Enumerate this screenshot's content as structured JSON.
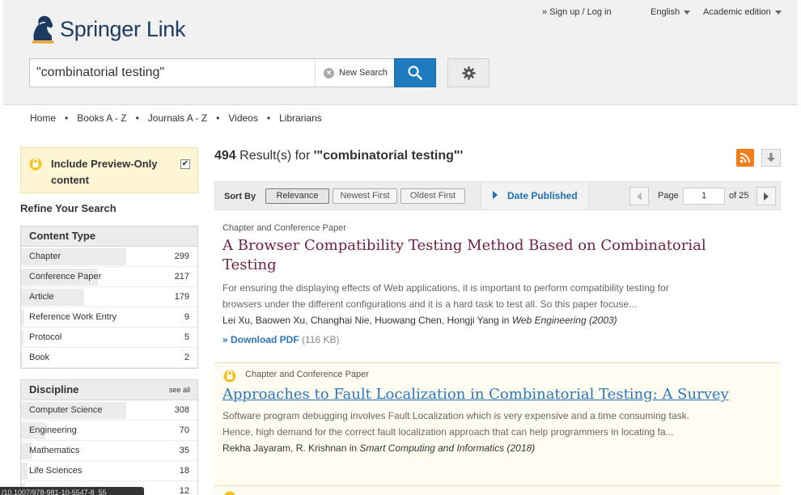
{
  "header": {
    "logo_brand": "Springer",
    "logo_suffix": "Link",
    "signin": "» Sign up / Log in",
    "language": "English",
    "edition": "Academic edition"
  },
  "search": {
    "query": "\"combinatorial testing\"",
    "new_search_label": "New Search"
  },
  "nav": [
    "Home",
    "Books A - Z",
    "Journals A - Z",
    "Videos",
    "Librarians"
  ],
  "sidebar": {
    "preview_label_line1": "Include Preview-Only",
    "preview_label_line2": "content",
    "preview_checked": "✔",
    "refine_title": "Refine Your Search",
    "content_type": {
      "title": "Content Type",
      "items": [
        {
          "label": "Chapter",
          "count": "299",
          "fraction": 1.0
        },
        {
          "label": "Conference Paper",
          "count": "217",
          "fraction": 0.73
        },
        {
          "label": "Article",
          "count": "179",
          "fraction": 0.6
        },
        {
          "label": "Reference Work Entry",
          "count": "9",
          "fraction": 0.03
        },
        {
          "label": "Protocol",
          "count": "5",
          "fraction": 0.02
        },
        {
          "label": "Book",
          "count": "2",
          "fraction": 0.01
        }
      ]
    },
    "discipline": {
      "title": "Discipline",
      "see_all": "see all",
      "items": [
        {
          "label": "Computer Science",
          "count": "308",
          "fraction": 1.0
        },
        {
          "label": "Engineering",
          "count": "70",
          "fraction": 0.23
        },
        {
          "label": "Mathematics",
          "count": "35",
          "fraction": 0.11
        },
        {
          "label": "Life Sciences",
          "count": "18",
          "fraction": 0.06
        },
        {
          "label": "",
          "count": "12",
          "fraction": 0.04
        }
      ]
    }
  },
  "results": {
    "count": "494",
    "label": "Result(s) for",
    "query": "'\"combinatorial testing\"'",
    "sort_label": "Sort By",
    "sort_options": [
      "Relevance",
      "Newest First",
      "Oldest First"
    ],
    "date_published": "Date Published",
    "page_label": "Page",
    "page_value": "1",
    "page_of": "of 25",
    "items": [
      {
        "type": "Chapter and Conference Paper",
        "title_line1": "A Browser Compatibility Testing Method Based on Combinatorial",
        "title_line2": "Testing",
        "snippet_line1": "For ensuring the displaying effects of Web applications, it is important to perform compatibility testing for",
        "snippet_line2": "browsers under the different configurations and it is a hard task to test all. So this paper focuse...",
        "authors": "Lei Xu, Baowen Xu, Changhai Nie, Huowang Chen, Hongji Yang in",
        "source": "Web Engineering (2003)",
        "download": "» Download PDF",
        "download_size": "(116 KB)"
      },
      {
        "type": "Chapter and Conference Paper",
        "title": "Approaches to Fault Localization in Combinatorial Testing: A Survey",
        "snippet_line1": "Software program debugging involves Fault Localization which is very expensive and a time consuming task.",
        "snippet_line2": "Hence, high demand for the correct fault localization approach that can help programmers in locating fa...",
        "authors": "Rekha Jayaram, R. Krishnan in",
        "source": "Smart Computing and Informatics (2018)"
      }
    ]
  },
  "status_url": "/10.1007/978-981-10-5547-8_55",
  "colors": {
    "brand_blue": "#1f7bc0",
    "title_maroon": "#6d2345",
    "link_blue": "#2d76b6",
    "rss_orange": "#f07e1b",
    "preview_yellow": "#fdf5d3"
  }
}
